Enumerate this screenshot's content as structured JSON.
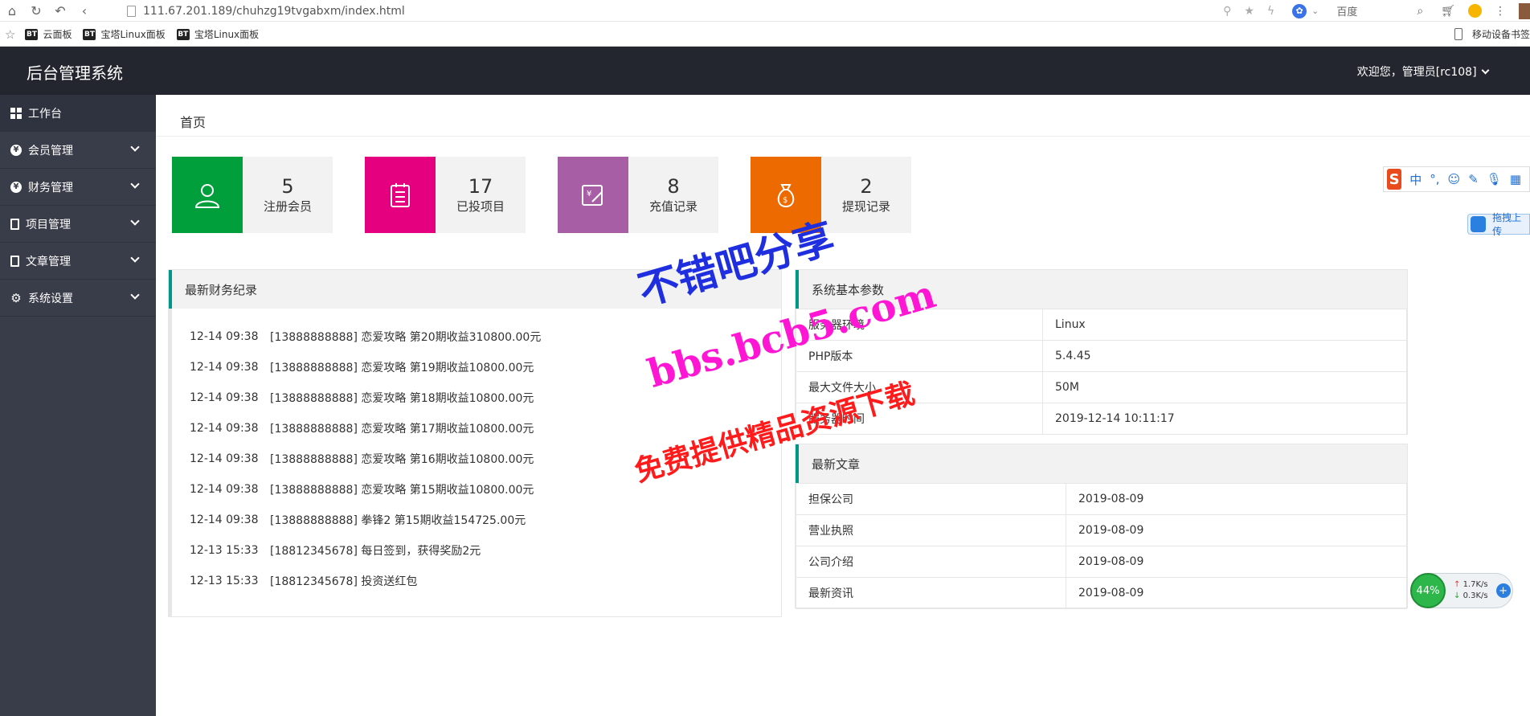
{
  "browser": {
    "url": "111.67.201.189/chuhzg19tvgabxm/index.html",
    "search_engine": "百度",
    "bookmarks": [
      "云面板",
      "宝塔Linux面板",
      "宝塔Linux面板"
    ],
    "bt_badge": "BT",
    "mobile_bookmarks": "移动设备书签"
  },
  "header": {
    "title": "后台管理系统",
    "welcome": "欢迎您，管理员[rc108]"
  },
  "sidebar": {
    "items": [
      {
        "label": "工作台"
      },
      {
        "label": "会员管理"
      },
      {
        "label": "财务管理"
      },
      {
        "label": "项目管理"
      },
      {
        "label": "文章管理"
      },
      {
        "label": "系统设置"
      }
    ]
  },
  "tabs": {
    "home": "首页"
  },
  "stats": [
    {
      "value": "5",
      "label": "注册会员",
      "color": "#009f3c"
    },
    {
      "value": "17",
      "label": "已投项目",
      "color": "#e4007f"
    },
    {
      "value": "8",
      "label": "充值记录",
      "color": "#a85ea4"
    },
    {
      "value": "2",
      "label": "提现记录",
      "color": "#ec6a00"
    }
  ],
  "finance": {
    "title": "最新财务纪录",
    "records": [
      {
        "time": "12-14 09:38",
        "text": "[13888888888] 恋爱攻略 第20期收益310800.00元"
      },
      {
        "time": "12-14 09:38",
        "text": "[13888888888] 恋爱攻略 第19期收益10800.00元"
      },
      {
        "time": "12-14 09:38",
        "text": "[13888888888] 恋爱攻略 第18期收益10800.00元"
      },
      {
        "time": "12-14 09:38",
        "text": "[13888888888] 恋爱攻略 第17期收益10800.00元"
      },
      {
        "time": "12-14 09:38",
        "text": "[13888888888] 恋爱攻略 第16期收益10800.00元"
      },
      {
        "time": "12-14 09:38",
        "text": "[13888888888] 恋爱攻略 第15期收益10800.00元"
      },
      {
        "time": "12-14 09:38",
        "text": "[13888888888] 拳锋2 第15期收益154725.00元"
      },
      {
        "time": "12-13 15:33",
        "text": "[18812345678] 每日签到，获得奖励2元"
      },
      {
        "time": "12-13 15:33",
        "text": "[18812345678] 投资送红包"
      }
    ]
  },
  "system": {
    "title": "系统基本参数",
    "rows": [
      {
        "key": "服务器环境",
        "value": "Linux"
      },
      {
        "key": "PHP版本",
        "value": "5.4.45"
      },
      {
        "key": "最大文件大小",
        "value": "50M"
      },
      {
        "key": "服务器时间",
        "value": "2019-12-14 10:11:17"
      }
    ]
  },
  "articles": {
    "title": "最新文章",
    "rows": [
      {
        "name": "担保公司",
        "date": "2019-08-09"
      },
      {
        "name": "营业执照",
        "date": "2019-08-09"
      },
      {
        "name": "公司介绍",
        "date": "2019-08-09"
      },
      {
        "name": "最新资讯",
        "date": "2019-08-09"
      }
    ]
  },
  "watermark": {
    "line1": "不错吧分享",
    "line2": "bbs.bcb5.com",
    "line3": "免费提供精品资源下载"
  },
  "widgets": {
    "ime_logo": "S",
    "ime_mode": "中",
    "cloud_label": "拖拽上传",
    "speed_percent": "44%",
    "speed_up": "1.7K/s",
    "speed_down": "0.3K/s",
    "speed_plus": "+"
  }
}
